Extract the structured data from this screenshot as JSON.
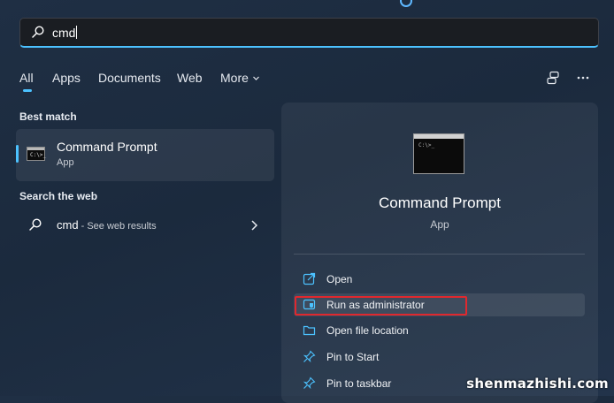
{
  "search": {
    "query": "cmd"
  },
  "tabs": [
    "All",
    "Apps",
    "Documents",
    "Web",
    "More"
  ],
  "sections": {
    "best_match": "Best match",
    "search_web": "Search the web"
  },
  "best_match": {
    "name": "Command Prompt",
    "kind": "App"
  },
  "web_result": {
    "query": "cmd",
    "suffix": " - See web results"
  },
  "detail": {
    "title": "Command Prompt",
    "subtitle": "App",
    "actions": [
      "Open",
      "Run as administrator",
      "Open file location",
      "Pin to Start",
      "Pin to taskbar"
    ]
  },
  "icons": {
    "search": "search-icon",
    "more": "chevron-down-icon",
    "share": "share-icon",
    "overflow": "ellipsis-icon",
    "open": "open-external-icon",
    "admin": "shield-admin-icon",
    "folder": "folder-icon",
    "pin": "pin-icon",
    "chevron": "chevron-right-icon"
  },
  "colors": {
    "accent": "#4cc2ff",
    "highlight": "#e0282e"
  },
  "watermark": "shenmazhishi.com"
}
